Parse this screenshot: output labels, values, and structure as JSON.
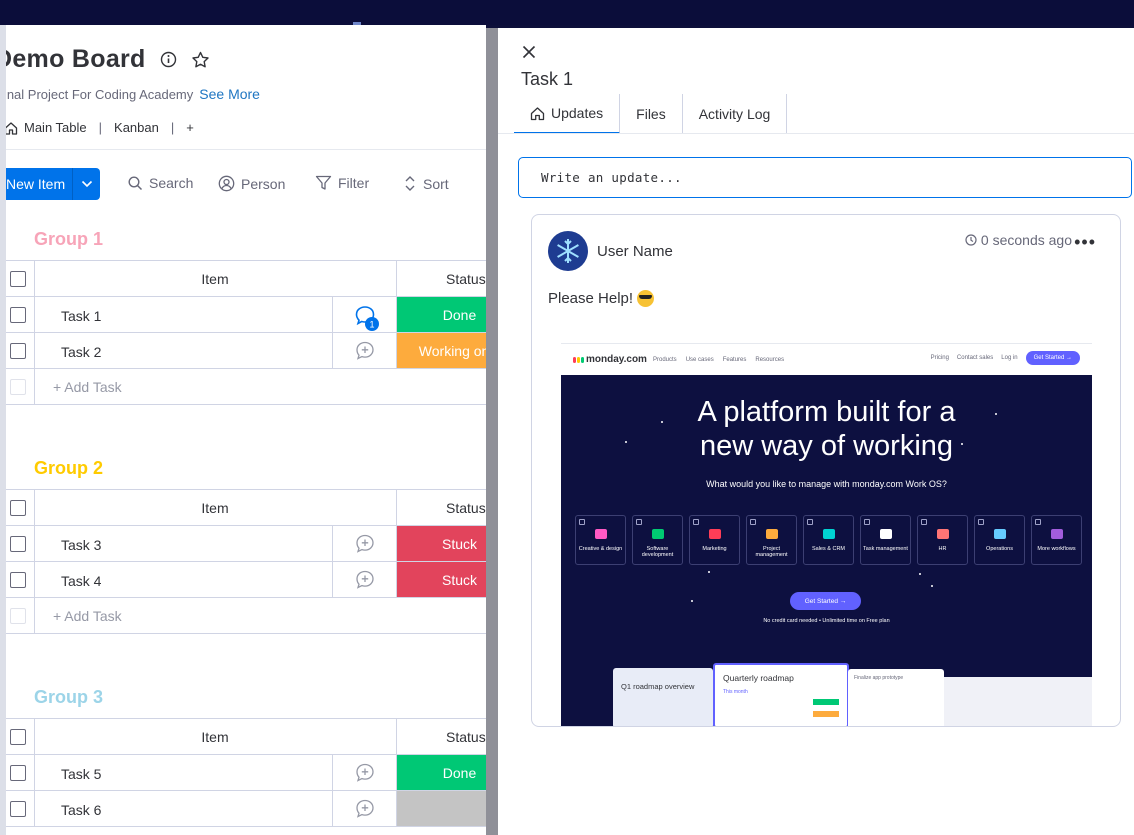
{
  "board": {
    "title": "Demo Board",
    "description": "Final Project For Coding Academy",
    "see_more": "See More",
    "views": {
      "main_table": "Main Table",
      "kanban": "Kanban",
      "add": "+"
    },
    "toolbar": {
      "new_item": "New Item",
      "search": "Search",
      "person": "Person",
      "filter": "Filter",
      "sort": "Sort"
    },
    "columns": {
      "item": "Item",
      "status": "Status"
    },
    "add_task": "+ Add Task",
    "groups": [
      {
        "title": "Group 1",
        "color": "#f7a4b8",
        "tasks": [
          {
            "name": "Task 1",
            "updates": "1",
            "status": "Done",
            "status_color": "#00c875"
          },
          {
            "name": "Task 2",
            "updates": "",
            "status": "Working on it",
            "status_color": "#fdab3d"
          }
        ]
      },
      {
        "title": "Group 2",
        "color": "#ffcb00",
        "tasks": [
          {
            "name": "Task 3",
            "updates": "",
            "status": "Stuck",
            "status_color": "#e2445c"
          },
          {
            "name": "Task 4",
            "updates": "",
            "status": "Stuck",
            "status_color": "#e2445c"
          }
        ]
      },
      {
        "title": "Group 3",
        "color": "#9cd4e8",
        "tasks": [
          {
            "name": "Task 5",
            "updates": "",
            "status": "Done",
            "status_color": "#00c875"
          },
          {
            "name": "Task 6",
            "updates": "",
            "status": "",
            "status_color": "#c4c4c4"
          }
        ]
      }
    ]
  },
  "panel": {
    "task_title": "Task 1",
    "tabs": [
      "Updates",
      "Files",
      "Activity Log"
    ],
    "write_placeholder": "Write an update...",
    "post": {
      "user": "User Name",
      "time": "0 seconds ago",
      "text": "Please Help!",
      "screenshot": {
        "logo": "monday.com",
        "nav_links": [
          "Products",
          "Use cases",
          "Features",
          "Resources"
        ],
        "nav_right": [
          "Pricing",
          "Contact sales",
          "Log in"
        ],
        "nav_cta": "Get Started →",
        "hero_line1": "A platform built for a",
        "hero_line2": "new way of working",
        "hero_sub": "What would you like to manage with monday.com Work OS?",
        "cards": [
          {
            "label": "Creative & design",
            "color": "#ff5ac4"
          },
          {
            "label": "Software development",
            "color": "#00ca72"
          },
          {
            "label": "Marketing",
            "color": "#ff3d57"
          },
          {
            "label": "Project management",
            "color": "#fdab3d"
          },
          {
            "label": "Sales & CRM",
            "color": "#00d2d2"
          },
          {
            "label": "Task management",
            "color": "#ffffff"
          },
          {
            "label": "HR",
            "color": "#ff7575"
          },
          {
            "label": "Operations",
            "color": "#66ccff"
          },
          {
            "label": "More workflows",
            "color": "#a25ddc"
          }
        ],
        "get_started": "Get Started →",
        "fine_print": "No credit card needed  •  Unlimited time on Free plan",
        "dash_left": "Q1 roadmap overview",
        "dash_center": "Quarterly roadmap",
        "dash_center_sub": "This month",
        "dash_right": "Finalize app prototype"
      }
    }
  }
}
